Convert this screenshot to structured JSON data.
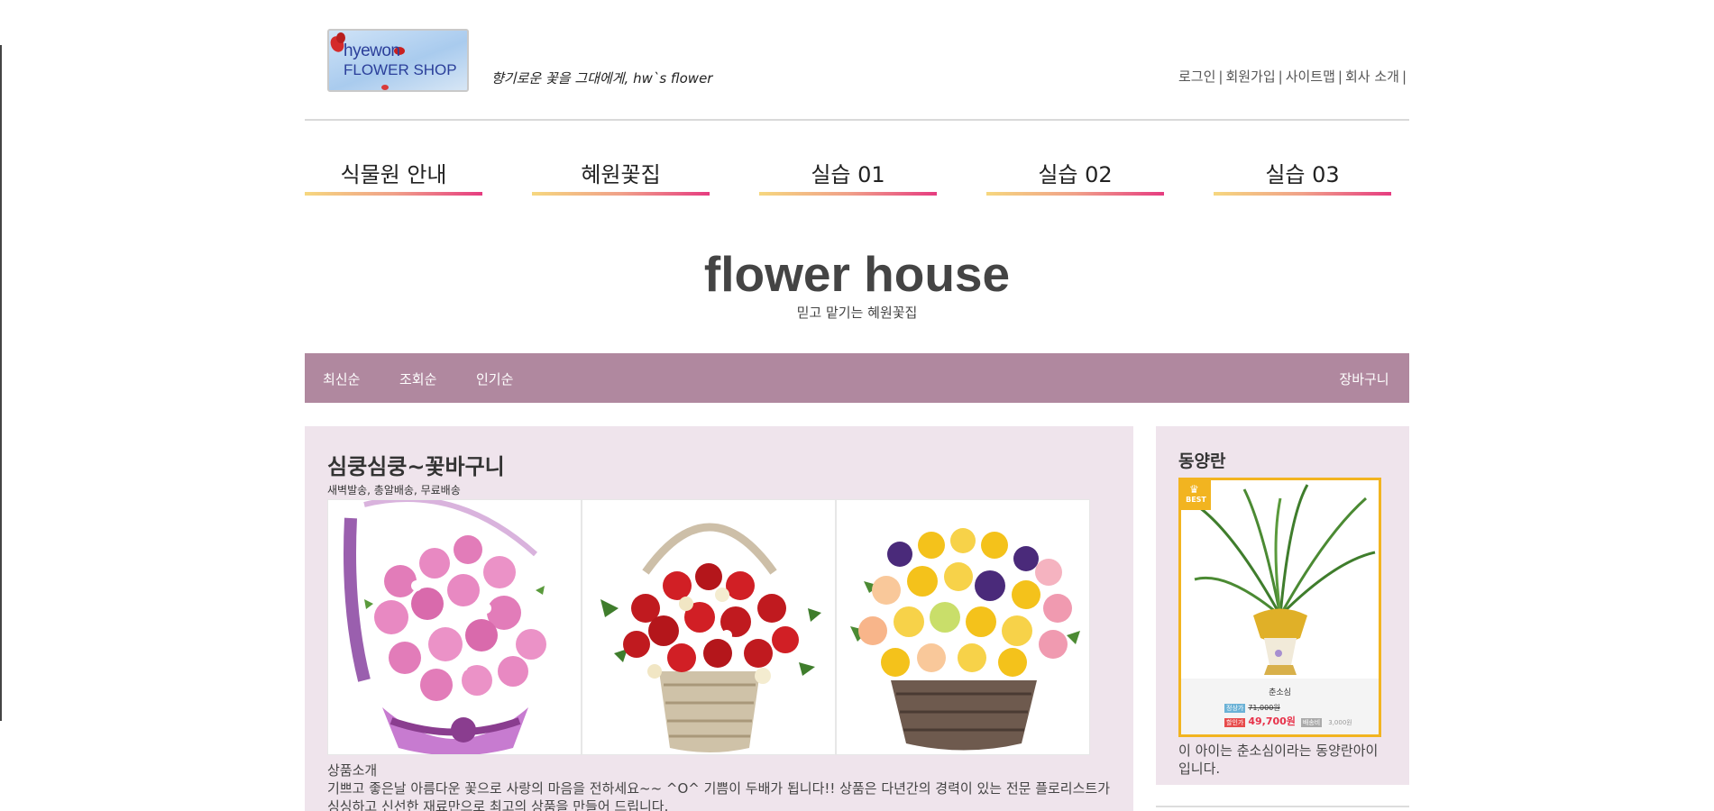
{
  "header": {
    "logo_line1": "hyewon",
    "logo_line2": "FLOWER SHOP",
    "slogan": "향기로운 꽃을 그대에게, hw`s flower",
    "links": [
      "로그인",
      "회원가입",
      "사이트맵",
      "회사 소개"
    ]
  },
  "main_nav": [
    "식물원 안내",
    "혜원꽃집",
    "실습 01",
    "실습 02",
    "실습 03"
  ],
  "hero": {
    "title": "flower house",
    "subtitle": "믿고 맡기는 혜원꽃집"
  },
  "sub_nav": {
    "tabs": [
      "최신순",
      "조회순",
      "인기순"
    ],
    "cart": "장바구니"
  },
  "product": {
    "title": "심쿵심쿵~꽃바구니",
    "shipping": "새벽발송, 총알배송, 무료배송",
    "desc_title": "상품소개",
    "desc": "기쁘고 좋은날 아름다운 꽃으로 사랑의 마음을 전하세요~~ ^O^   기쁨이 두배가 됩니다!! 상품은 다년간의 경력이 있는 전문 플로리스트가 싱싱하고 신선한 재료만으로 최고의 상품을 만들어 드립니다."
  },
  "side": {
    "title": "동양란",
    "best_label": "BEST",
    "product_name": "춘소심",
    "tag_list": "정상가",
    "old_price": "71,000원",
    "tag_sale": "할인가",
    "new_price": "49,700원",
    "tag_ship": "배송비",
    "ship_price": "3,000원",
    "note": "이 아이는 춘소심이라는 동양란아이입니다."
  },
  "colors": {
    "subbar": "#b0889f",
    "panel": "#efe4ec",
    "best": "#f2b420",
    "nav_gradient": [
      "#f6d77f",
      "#e63c80"
    ]
  }
}
